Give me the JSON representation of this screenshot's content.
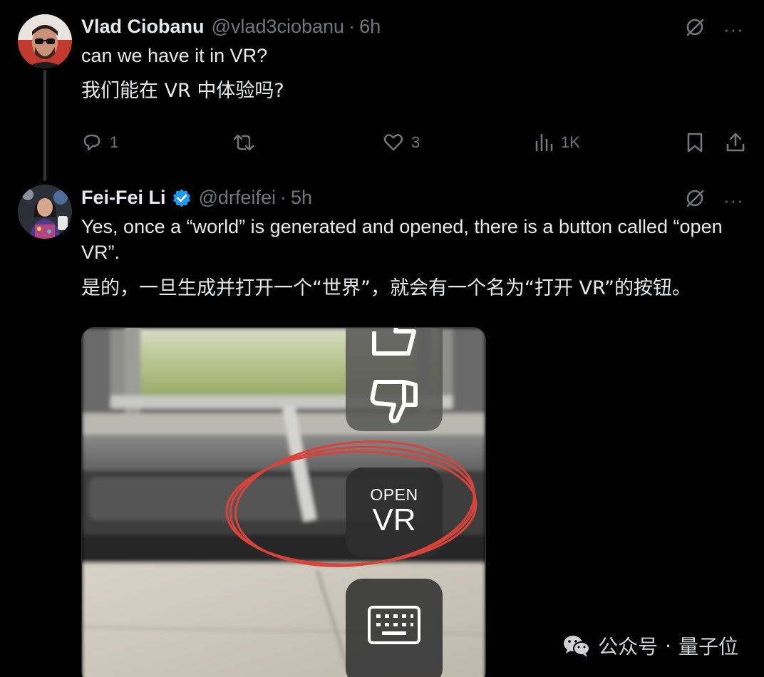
{
  "posts": [
    {
      "author": {
        "name": "Vlad Ciobanu",
        "handle": "@vlad3ciobanu",
        "time": "6h",
        "verified": false
      },
      "text": "can we have it in VR?",
      "translation": "我们能在 VR 中体验吗?",
      "stats": {
        "replies": "1",
        "retweets": "",
        "likes": "3",
        "views": "1K"
      }
    },
    {
      "author": {
        "name": "Fei-Fei Li",
        "handle": "@drfeifei",
        "time": "5h",
        "verified": true
      },
      "text": "Yes, once a “world” is generated and opened, there is a button called “open VR”.",
      "translation": "是的，一旦生成并打开一个“世界”，就会有一个名为“打开 VR”的按钮。",
      "media": {
        "button_top_label": "OPEN",
        "button_main_label": "VR"
      }
    }
  ],
  "separator": "·",
  "more_label": "···",
  "watermark": {
    "left": "公众号",
    "dot": "·",
    "right": "量子位"
  },
  "colors": {
    "background": "#000000",
    "text": "#e7e9ea",
    "muted": "#71767b",
    "verified": "#1d9bf0",
    "annotation_circle": "#d8433b"
  }
}
